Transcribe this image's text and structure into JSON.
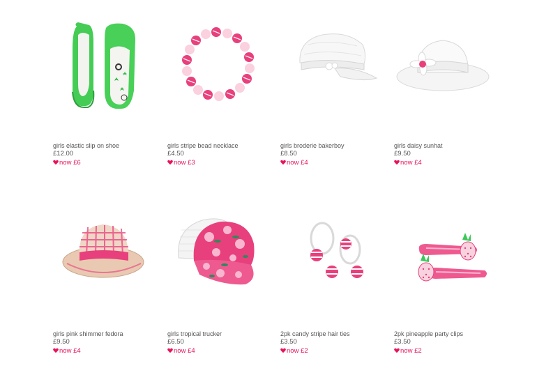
{
  "products": [
    {
      "name": "girls elastic slip on shoe",
      "price": "£12.00",
      "sale": "now £6",
      "icon": "shoe-image"
    },
    {
      "name": "girls stripe bead necklace",
      "price": "£4.50",
      "sale": "now £3",
      "icon": "necklace-image"
    },
    {
      "name": "girls broderie bakerboy",
      "price": "£8.50",
      "sale": "now £4",
      "icon": "bakerboy-cap-image"
    },
    {
      "name": "girls daisy sunhat",
      "price": "£9.50",
      "sale": "now £4",
      "icon": "sunhat-image"
    },
    {
      "name": "girls pink shimmer fedora",
      "price": "£9.50",
      "sale": "now £4",
      "icon": "fedora-image"
    },
    {
      "name": "girls tropical trucker",
      "price": "£6.50",
      "sale": "now £4",
      "icon": "trucker-cap-image"
    },
    {
      "name": "2pk candy stripe hair ties",
      "price": "£3.50",
      "sale": "now £2",
      "icon": "hair-ties-image"
    },
    {
      "name": "2pk pineapple party clips",
      "price": "£3.50",
      "sale": "now £2",
      "icon": "hair-clips-image"
    }
  ],
  "colors": {
    "sale": "#e8125c",
    "text": "#555555",
    "accent_pink": "#e83f7e",
    "accent_green": "#3cc85a"
  }
}
